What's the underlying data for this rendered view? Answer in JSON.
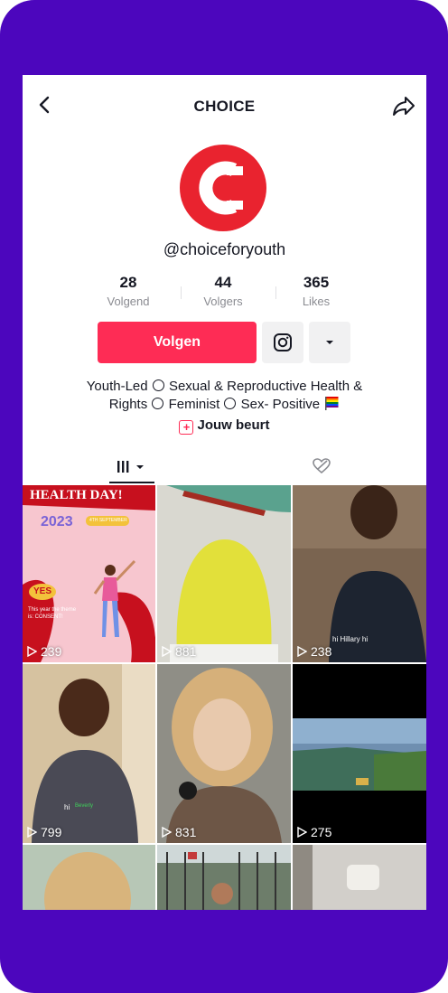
{
  "header": {
    "title": "CHOICE"
  },
  "profile": {
    "username": "@choiceforyouth",
    "stats": [
      {
        "value": "28",
        "label": "Volgend"
      },
      {
        "value": "44",
        "label": "Volgers"
      },
      {
        "value": "365",
        "label": "Likes"
      }
    ],
    "follow_label": "Volgen",
    "bio_line1_parts": [
      "Youth-Led",
      "Sexual & Reproductive Health &"
    ],
    "bio_line2_parts": [
      "Rights",
      "Feminist",
      "Sex- Positive"
    ],
    "link_label": "Jouw beurt"
  },
  "videos": [
    {
      "views": "239",
      "title": "HEALTH DAY!",
      "year": "2023",
      "badge": "4TH SEPTEMBER",
      "yes": "YES",
      "caption": "This year the theme is: CONSENT!"
    },
    {
      "views": "881",
      "caption": ""
    },
    {
      "views": "238",
      "caption": "hi Hillary hi"
    },
    {
      "views": "799",
      "caption": "hi",
      "caption2": "Beverly"
    },
    {
      "views": "831",
      "caption": ""
    },
    {
      "views": "275",
      "caption": ""
    },
    {
      "views": ""
    },
    {
      "views": ""
    },
    {
      "views": ""
    }
  ],
  "colors": {
    "frame": "#4c06bd",
    "accent": "#fe2c55",
    "logo": "#e9232f"
  }
}
